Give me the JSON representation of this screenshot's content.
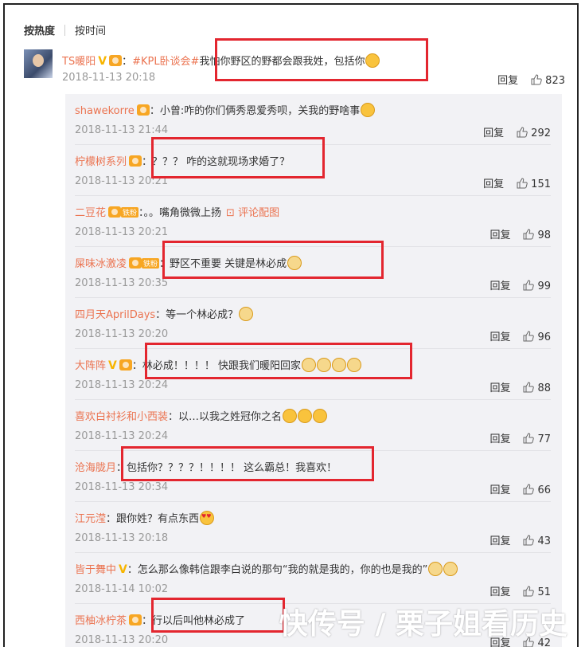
{
  "sort": {
    "hot": "按热度",
    "time": "按时间"
  },
  "top_comment": {
    "user": "TS暖阳",
    "topic": "#KPL卧谈会#",
    "text": "我怕你野区的野都会跟我姓，包括你",
    "date": "2018-11-13 20:18",
    "reply": "回复",
    "likes": "823"
  },
  "replies": [
    {
      "user": "shawekorre",
      "text": "：小曾:咋的你们俩秀恩爱秀呗，关我的野啥事",
      "date": "2018-11-13 21:44",
      "reply": "回复",
      "likes": "292"
    },
    {
      "user": "柠檬树系列",
      "text": "：？？？ 咋的这就现场求婚了？",
      "date": "2018-11-13 20:21",
      "reply": "回复",
      "likes": "151"
    },
    {
      "user": "二豆花",
      "badge": "铁粉",
      "text": "：。。嘴角微微上扬",
      "image_label": "评论配图",
      "date": "2018-11-13 20:21",
      "reply": "回复",
      "likes": "98"
    },
    {
      "user": "屎味冰激凌",
      "badge": "铁粉",
      "text": "：野区不重要 关键是林必成",
      "date": "2018-11-13 20:35",
      "reply": "回复",
      "likes": "99"
    },
    {
      "user": "四月天AprilDays",
      "text": "：等一个林必成？",
      "date": "2018-11-13 20:20",
      "reply": "回复",
      "likes": "96"
    },
    {
      "user": "大阵阵",
      "text": "：林必成！！！！ 快跟我们暖阳回家",
      "date": "2018-11-13 20:24",
      "reply": "回复",
      "likes": "88"
    },
    {
      "user": "喜欢白衬衫和小西装",
      "text": "：以…以我之姓冠你之名",
      "date": "2018-11-13 20:24",
      "reply": "回复",
      "likes": "77"
    },
    {
      "user": "沧海胧月",
      "text": "：包括你？？？？！！！！ 这么霸总！我喜欢！",
      "date": "2018-11-13 20:34",
      "reply": "回复",
      "likes": "66"
    },
    {
      "user": "江元滢",
      "text": "：跟你姓？有点东西",
      "date": "2018-11-13 20:18",
      "reply": "回复",
      "likes": "43"
    },
    {
      "user": "皆于舞中",
      "text": "：怎么那么像韩信跟李白说的那句“我的就是我的，你的也是我的”",
      "date": "2018-11-14 10:02",
      "reply": "回复",
      "likes": "51"
    },
    {
      "user": "西柚冰柠茶",
      "text": "：行以后叫他林必成了",
      "date": "2018-11-13 20:20",
      "reply": "回复",
      "likes": "42"
    }
  ],
  "watermark": "快传号 / 栗子姐看历史"
}
